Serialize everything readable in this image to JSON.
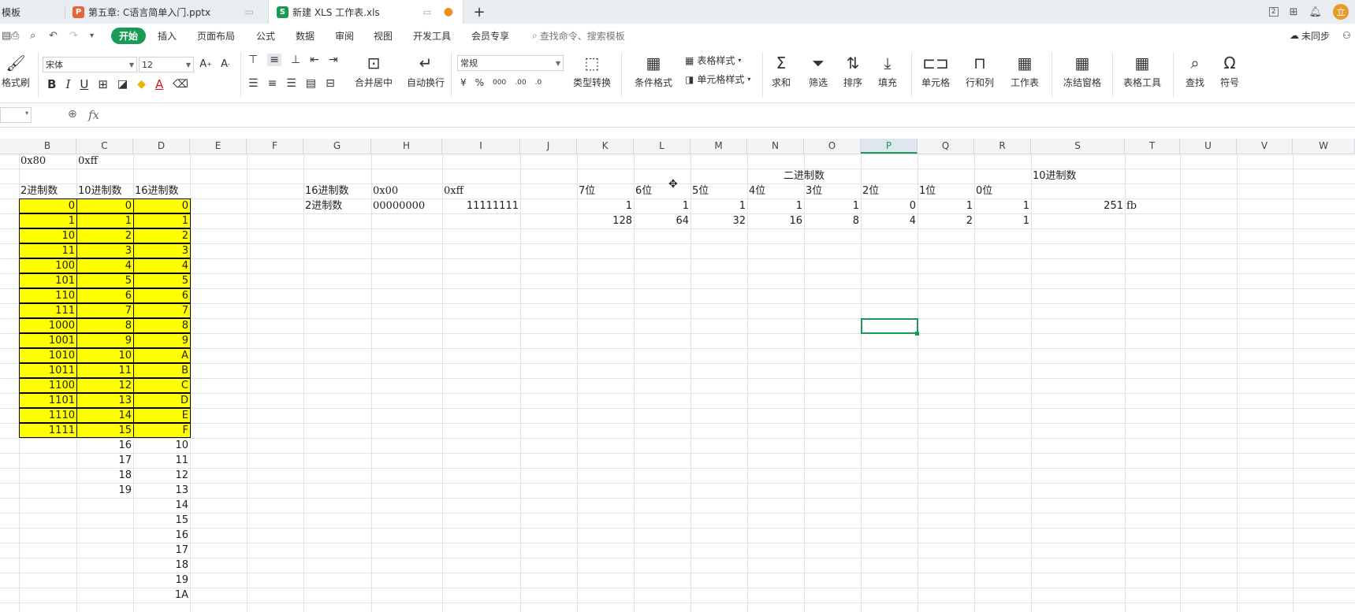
{
  "tabs": [
    {
      "label": "模板",
      "icon": "",
      "active": false
    },
    {
      "label": "第五章: C语言简单入门.pptx",
      "icon": "P",
      "active": false
    },
    {
      "label": "新建 XLS 工作表.xls",
      "icon": "S",
      "active": true
    }
  ],
  "tab_add": "+",
  "window": {
    "layout_badge": "2",
    "avatar": "立"
  },
  "menu": {
    "items": [
      "开始",
      "插入",
      "页面布局",
      "公式",
      "数据",
      "审阅",
      "视图",
      "开发工具",
      "会员专享"
    ],
    "search_placeholder": "查找命令、搜索模板",
    "sync_label": "未同步"
  },
  "ribbon": {
    "format_painter": "格式刷",
    "font_name": "宋体",
    "font_size": "12",
    "merge_center": "合并居中",
    "wrap_text": "自动换行",
    "number_format": "常规",
    "type_convert": "类型转换",
    "conditional_format": "条件格式",
    "table_style": "表格样式",
    "cell_style": "单元格样式",
    "sum": "求和",
    "filter": "筛选",
    "sort": "排序",
    "fill": "填充",
    "cells": "单元格",
    "row_col": "行和列",
    "worksheet": "工作表",
    "freeze": "冻结窗格",
    "table_tools": "表格工具",
    "find": "查找",
    "symbol": "符号"
  },
  "formula_bar": {
    "fx": "fx",
    "value": ""
  },
  "columns": [
    "B",
    "C",
    "D",
    "E",
    "F",
    "G",
    "H",
    "I",
    "J",
    "K",
    "L",
    "M",
    "N",
    "O",
    "P",
    "Q",
    "R",
    "S",
    "T",
    "U",
    "V",
    "W"
  ],
  "selected_column": "P",
  "sheet": {
    "b1": "0x80",
    "c1": "0xff",
    "headers_left": [
      "2进制数",
      "10进制数",
      "16进制数"
    ],
    "table": [
      [
        "0",
        "0",
        "0"
      ],
      [
        "1",
        "1",
        "1"
      ],
      [
        "10",
        "2",
        "2"
      ],
      [
        "11",
        "3",
        "3"
      ],
      [
        "100",
        "4",
        "4"
      ],
      [
        "101",
        "5",
        "5"
      ],
      [
        "110",
        "6",
        "6"
      ],
      [
        "111",
        "7",
        "7"
      ],
      [
        "1000",
        "8",
        "8"
      ],
      [
        "1001",
        "9",
        "9"
      ],
      [
        "1010",
        "10",
        "A"
      ],
      [
        "1011",
        "11",
        "B"
      ],
      [
        "1100",
        "12",
        "C"
      ],
      [
        "1101",
        "13",
        "D"
      ],
      [
        "1110",
        "14",
        "E"
      ],
      [
        "1111",
        "15",
        "F"
      ]
    ],
    "extra_c": [
      "16",
      "17",
      "18",
      "19"
    ],
    "extra_d": [
      "10",
      "11",
      "12",
      "13",
      "14",
      "15",
      "16",
      "17",
      "18",
      "19",
      "1A"
    ],
    "right_title_binary": "二进制数",
    "right_title_decimal": "10进制数",
    "g_labels": [
      "16进制数",
      "2进制数"
    ],
    "h_values": [
      "0x00",
      "00000000"
    ],
    "i_values": [
      "0xff",
      "11111111"
    ],
    "bit_headers": [
      "7位",
      "6位",
      "5位",
      "4位",
      "3位",
      "2位",
      "1位",
      "0位"
    ],
    "bits": [
      "1",
      "1",
      "1",
      "1",
      "1",
      "0",
      "1",
      "1"
    ],
    "weights": [
      "128",
      "64",
      "32",
      "16",
      "8",
      "4",
      "2",
      "1"
    ],
    "decimal_result": "251",
    "hex_result": "fb"
  },
  "colors": {
    "accent": "#1a9b55",
    "yellow": "#ffff00"
  }
}
